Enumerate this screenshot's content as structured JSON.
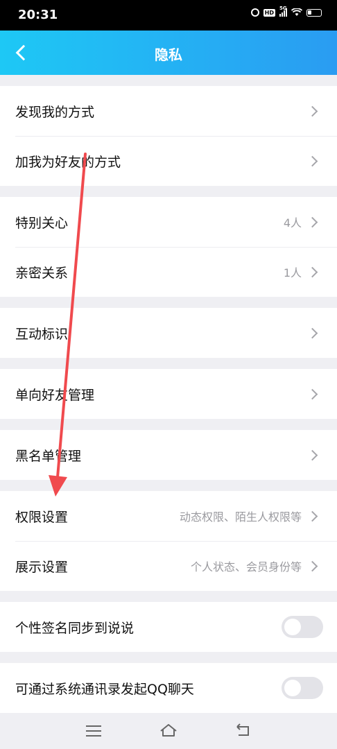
{
  "status_bar": {
    "time": "20:31",
    "hd_label": "HD",
    "network_label": "5G"
  },
  "header": {
    "title": "隐私",
    "back_icon": "chevron-left-icon"
  },
  "groups": [
    [
      {
        "label": "发现我的方式",
        "value": "",
        "type": "link"
      },
      {
        "label": "加我为好友的方式",
        "value": "",
        "type": "link"
      }
    ],
    [
      {
        "label": "特别关心",
        "value": "4人",
        "type": "link"
      },
      {
        "label": "亲密关系",
        "value": "1人",
        "type": "link"
      }
    ],
    [
      {
        "label": "互动标识",
        "value": "",
        "type": "link"
      }
    ],
    [
      {
        "label": "单向好友管理",
        "value": "",
        "type": "link"
      }
    ],
    [
      {
        "label": "黑名单管理",
        "value": "",
        "type": "link"
      }
    ],
    [
      {
        "label": "权限设置",
        "value": "动态权限、陌生人权限等",
        "type": "link"
      },
      {
        "label": "展示设置",
        "value": "个人状态、会员身份等",
        "type": "link"
      }
    ],
    [
      {
        "label": "个性签名同步到说说",
        "value": "",
        "type": "toggle",
        "on": false
      }
    ],
    [
      {
        "label": "可通过系统通讯录发起QQ聊天",
        "value": "",
        "type": "toggle",
        "on": false
      }
    ]
  ],
  "nav_bar": {
    "icons": [
      "menu-icon",
      "home-icon",
      "back-icon"
    ]
  },
  "colors": {
    "header_gradient_start": "#1ec8f5",
    "header_gradient_end": "#2a9cf2",
    "annotation_arrow": "#f04a4e"
  }
}
